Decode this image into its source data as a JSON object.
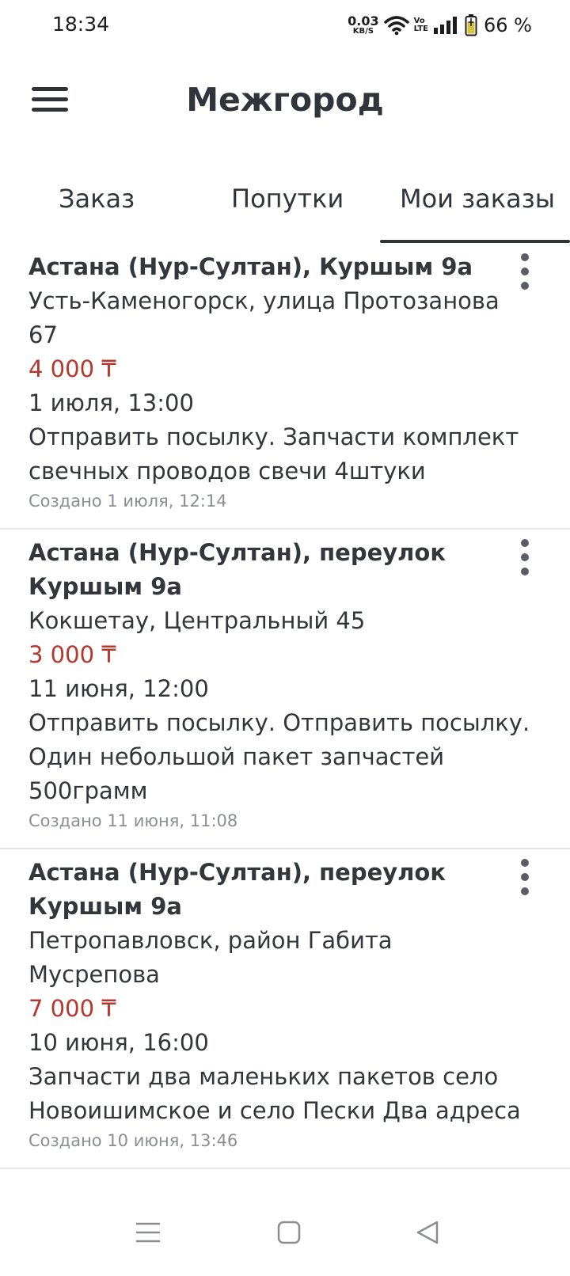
{
  "status_bar": {
    "time": "18:34",
    "net_speed_value": "0.03",
    "net_speed_unit": "KB/S",
    "volte_top": "Vo",
    "volte_bottom": "LTE",
    "battery": "66 %",
    "icons": [
      "wifi-icon",
      "volte-icon",
      "signal-icon",
      "battery-charging-icon"
    ]
  },
  "header": {
    "title": "Межгород",
    "menu_icon": "hamburger-menu-icon"
  },
  "tabs": [
    {
      "label": "Заказ",
      "active": false
    },
    {
      "label": "Попутки",
      "active": false
    },
    {
      "label": "Мои заказы",
      "active": true
    }
  ],
  "orders": [
    {
      "from": "Астана (Нур-Султан), Куршым 9а",
      "to": "Усть-Каменогорск, улица Протозанова 67",
      "price": "4 000 ₸",
      "date": "1 июля, 13:00",
      "description": "Отправить посылку. Запчасти комплект свечных проводов свечи 4штуки",
      "created": "Создано 1 июля, 12:14"
    },
    {
      "from": "Астана (Нур-Султан), переулок Куршым 9а",
      "to": "Кокшетау, Центральный 45",
      "price": "3 000 ₸",
      "date": "11 июня, 12:00",
      "description": "Отправить посылку. Отправить посылку. Один небольшой пакет запчастей 500грамм",
      "created": "Создано 11 июня, 11:08"
    },
    {
      "from": "Астана (Нур-Султан), переулок Куршым 9а",
      "to": "Петропавловск, район Габита Мусрепова",
      "price": "7 000 ₸",
      "date": "10 июня, 16:00",
      "description": "Запчасти два маленьких пакетов село Новоишимское и село Пески Два адреса",
      "created": "Создано 10 июня, 13:46"
    }
  ],
  "colors": {
    "price": "#b8372c",
    "text": "#33363b",
    "muted": "#8a8e93",
    "divider": "#e6e6e6"
  },
  "nav_bar": {
    "icons": [
      "recent-apps-icon",
      "home-icon",
      "back-icon"
    ]
  }
}
